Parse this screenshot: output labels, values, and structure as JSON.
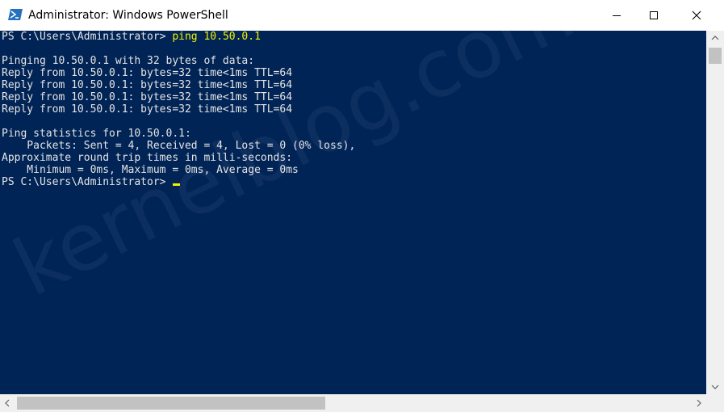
{
  "window": {
    "title": "Administrator: Windows PowerShell",
    "icon": "powershell-icon"
  },
  "controls": {
    "minimize_icon": "minimize-icon",
    "maximize_icon": "maximize-icon",
    "close_icon": "close-icon"
  },
  "console": {
    "background": "#012456",
    "foreground": "#e4e4e4",
    "command_color": "#f2f200",
    "lines": {
      "prompt1": "PS C:\\Users\\Administrator> ",
      "command": "ping 10.50.0.1",
      "blank1": "",
      "pinging": "Pinging 10.50.0.1 with 32 bytes of data:",
      "reply1": "Reply from 10.50.0.1: bytes=32 time<1ms TTL=64",
      "reply2": "Reply from 10.50.0.1: bytes=32 time<1ms TTL=64",
      "reply3": "Reply from 10.50.0.1: bytes=32 time<1ms TTL=64",
      "reply4": "Reply from 10.50.0.1: bytes=32 time<1ms TTL=64",
      "blank2": "",
      "stats_header": "Ping statistics for 10.50.0.1:",
      "packets": "    Packets: Sent = 4, Received = 4, Lost = 0 (0% loss),",
      "approx": "Approximate round trip times in milli-seconds:",
      "times": "    Minimum = 0ms, Maximum = 0ms, Average = 0ms",
      "prompt2": "PS C:\\Users\\Administrator> "
    },
    "watermark": "kernelblog.com"
  }
}
